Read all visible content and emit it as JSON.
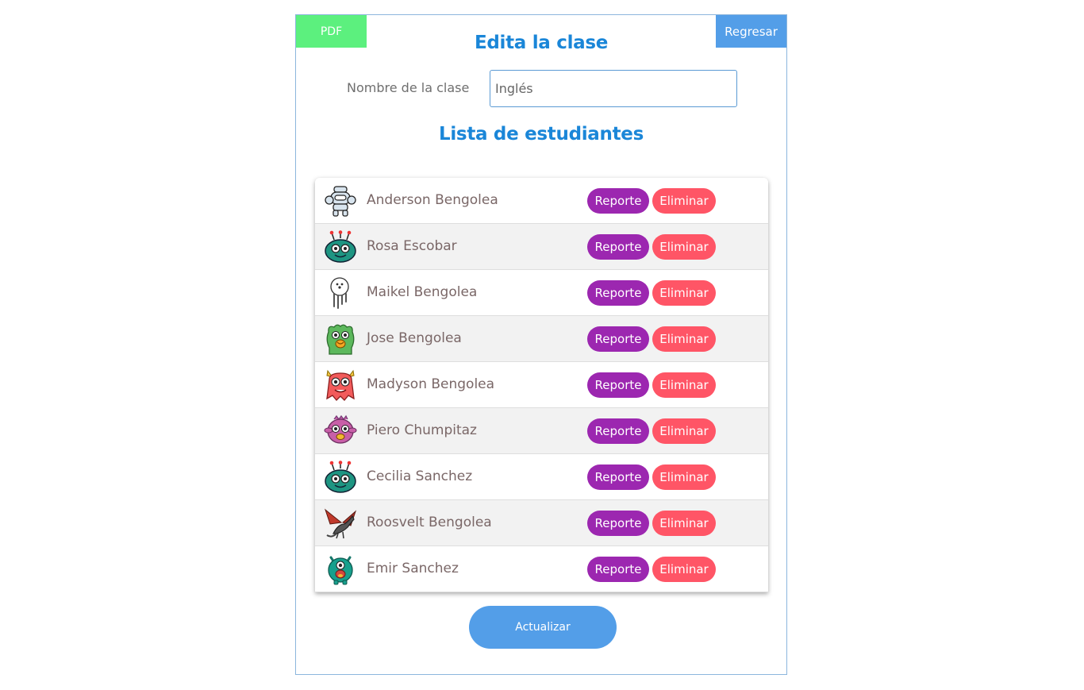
{
  "header": {
    "pdf_label": "PDF",
    "back_label": "Regresar",
    "title": "Edita la clase"
  },
  "form": {
    "class_name_label": "Nombre de la clase",
    "class_name_value": "Inglés"
  },
  "list_title": "Lista de estudiantes",
  "students": [
    {
      "name": "Anderson Bengolea",
      "avatar": "robot-icon"
    },
    {
      "name": "Rosa Escobar",
      "avatar": "green-alien-icon"
    },
    {
      "name": "Maikel Bengolea",
      "avatar": "ghost-icon"
    },
    {
      "name": "Jose Bengolea",
      "avatar": "green-monster-icon"
    },
    {
      "name": "Madyson Bengolea",
      "avatar": "red-monster-icon"
    },
    {
      "name": "Piero Chumpitaz",
      "avatar": "pink-monster-icon"
    },
    {
      "name": "Cecilia Sanchez",
      "avatar": "green-alien-icon"
    },
    {
      "name": "Roosvelt Bengolea",
      "avatar": "dragon-icon"
    },
    {
      "name": "Emir Sanchez",
      "avatar": "teal-monster-icon"
    }
  ],
  "actions": {
    "report_label": "Reporte",
    "delete_label": "Eliminar",
    "update_label": "Actualizar"
  },
  "colors": {
    "pdf": "#5cf07e",
    "back": "#539ee8",
    "title": "#1a86d8",
    "report": "#9c27b0",
    "delete": "#ff5566",
    "update": "#539ee8"
  }
}
